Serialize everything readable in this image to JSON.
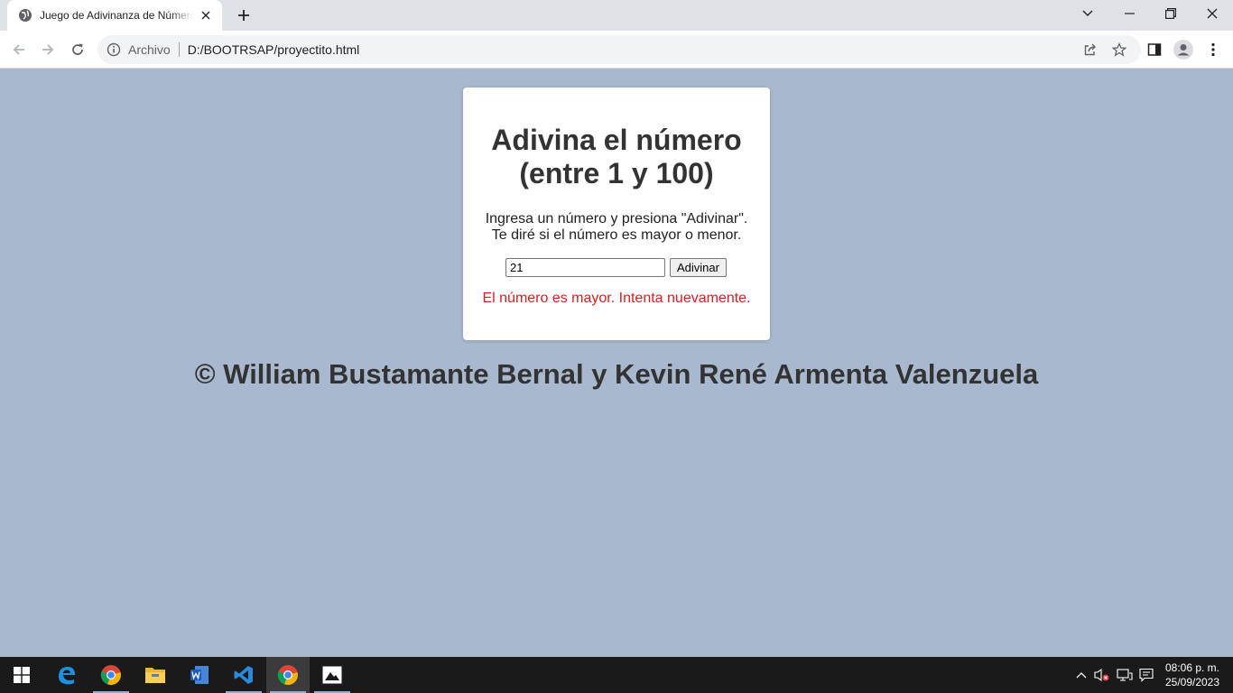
{
  "browser": {
    "tab_title": "Juego de Adivinanza de Números",
    "omnibox_chip": "Archivo",
    "url": "D:/BOOTRSAP/proyectito.html"
  },
  "page": {
    "heading_line1": "Adivina el número",
    "heading_line2": "(entre 1 y 100)",
    "instructions_line1": "Ingresa un número y presiona \"Adivinar\".",
    "instructions_line2": "Te diré si el número es mayor o menor.",
    "guess_value": "21",
    "guess_button": "Adivinar",
    "result_message": "El número es mayor. Intenta nuevamente.",
    "footer_credit": "© William Bustamante Bernal y Kevin René Armenta Valenzuela"
  },
  "taskbar": {
    "apps": [
      "windows-start",
      "edge",
      "chrome",
      "file-explorer",
      "word",
      "vscode",
      "chrome-active",
      "photos"
    ],
    "clock_time": "08:06 p. m.",
    "clock_date": "25/09/2023"
  },
  "colors": {
    "page_background": "#a8b9cf",
    "result_text": "#d42020",
    "heading_text": "#333333"
  }
}
